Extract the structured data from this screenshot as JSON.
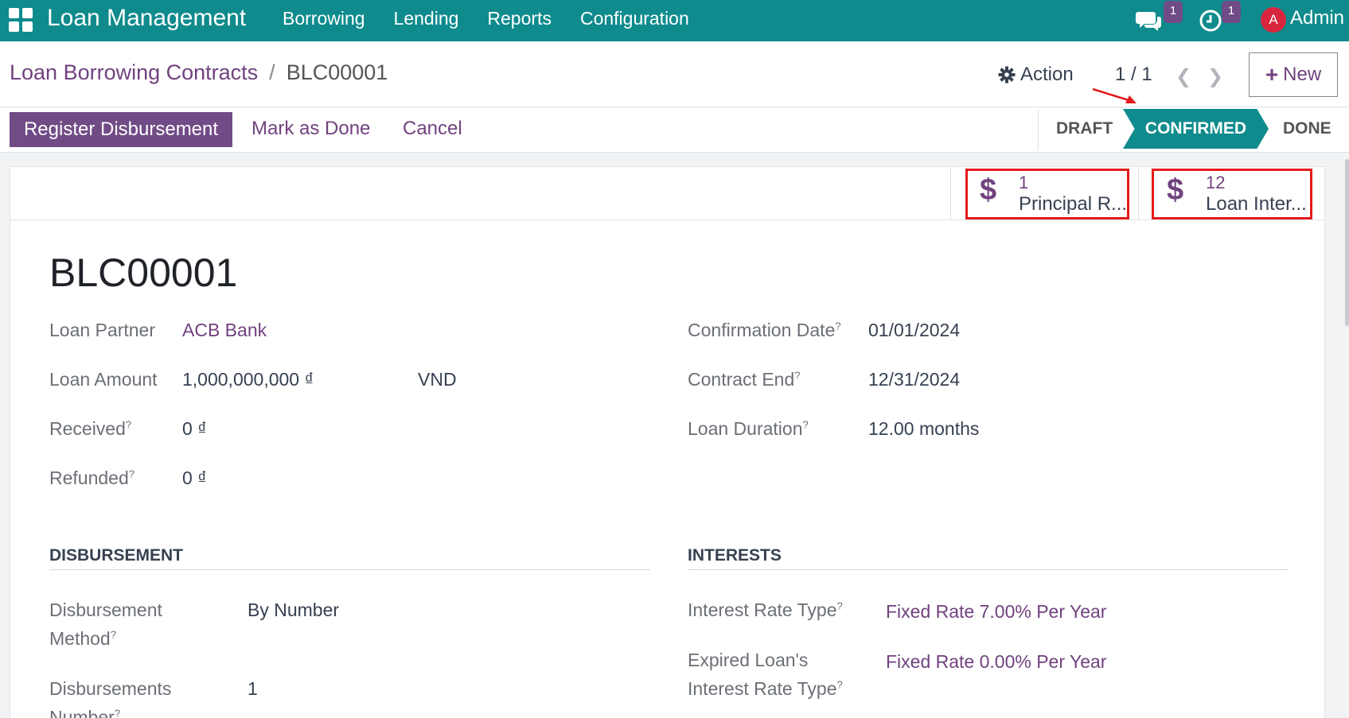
{
  "navbar": {
    "app_title": "Loan Management",
    "menu": [
      "Borrowing",
      "Lending",
      "Reports",
      "Configuration"
    ],
    "chat_count": "1",
    "activity_count": "1",
    "avatar_letter": "A",
    "user_name": "Admin"
  },
  "breadcrumb": {
    "parent": "Loan Borrowing Contracts",
    "separator": "/",
    "current": "BLC00001"
  },
  "control": {
    "action_label": "Action",
    "pager": "1 / 1",
    "new_label": "New"
  },
  "buttons": {
    "register": "Register Disbursement",
    "mark_done": "Mark as Done",
    "cancel": "Cancel"
  },
  "stages": {
    "draft": "DRAFT",
    "confirmed": "CONFIRMED",
    "done": "DONE"
  },
  "smart_buttons": [
    {
      "count": "1",
      "label": "Principal R..."
    },
    {
      "count": "12",
      "label": "Loan Inter..."
    }
  ],
  "record": {
    "name": "BLC00001",
    "loan_partner_label": "Loan Partner",
    "loan_partner": "ACB Bank",
    "loan_amount_label": "Loan Amount",
    "loan_amount": "1,000,000,000 ₫",
    "currency": "VND",
    "received_label": "Received",
    "received": "0 ₫",
    "refunded_label": "Refunded",
    "refunded": "0 ₫",
    "confirmation_date_label": "Confirmation Date",
    "confirmation_date": "01/01/2024",
    "contract_end_label": "Contract End",
    "contract_end": "12/31/2024",
    "loan_duration_label": "Loan Duration",
    "loan_duration": "12.00 months"
  },
  "disbursement": {
    "title": "DISBURSEMENT",
    "method_label_1": "Disbursement",
    "method_label_2": "Method",
    "method": "By Number",
    "number_label_1": "Disbursements",
    "number_label_2": "Number",
    "number": "1"
  },
  "interests": {
    "title": "INTERESTS",
    "rate_type_label": "Interest Rate Type",
    "rate_type": "Fixed Rate 7.00% Per Year",
    "expired_label_1": "Expired Loan's",
    "expired_label_2": "Interest Rate Type",
    "expired_rate": "Fixed Rate 0.00% Per Year"
  },
  "help_mark": "?",
  "colors": {
    "navbar": "#0f8b8d",
    "primary": "#714b86",
    "link": "#71427f",
    "highlight": "#e41a1c"
  }
}
